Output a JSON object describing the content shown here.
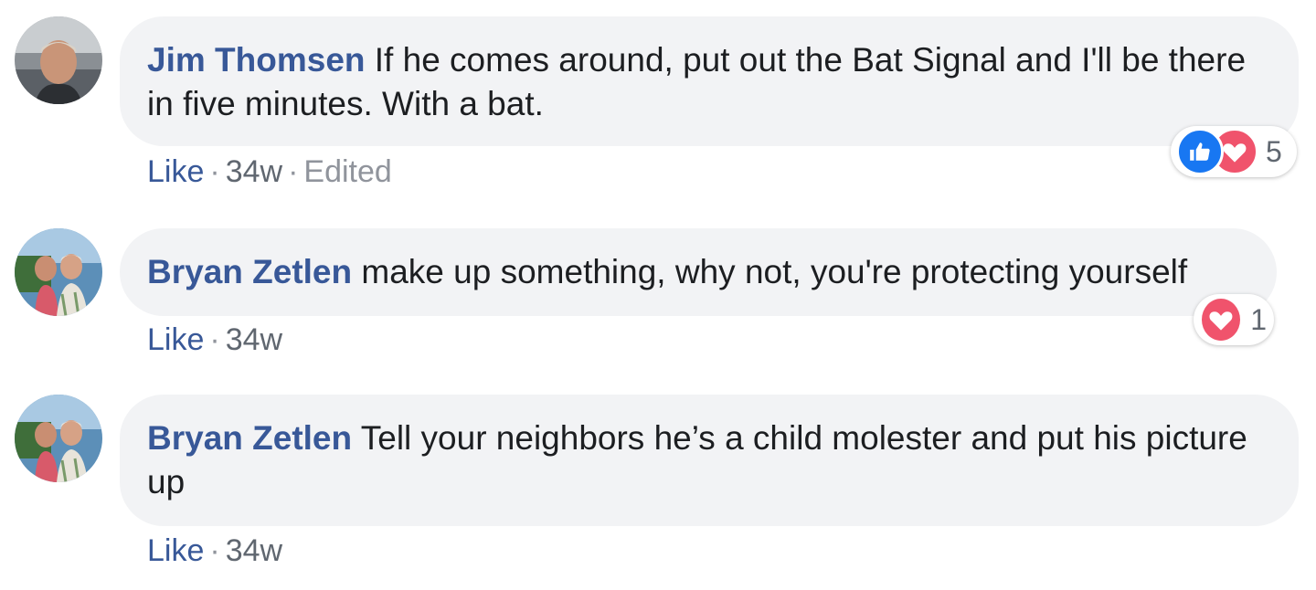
{
  "comments": [
    {
      "author": "Jim Thomsen",
      "text": "If he comes around, put out the Bat Signal and I'll be there in five minutes. With a bat.",
      "like_label": "Like",
      "time": "34w",
      "edited": "Edited",
      "reactions": [
        "like-icon",
        "love-icon"
      ],
      "reaction_count": "5"
    },
    {
      "author": "Bryan Zetlen",
      "text": "make up something, why not, you're protecting yourself",
      "like_label": "Like",
      "time": "34w",
      "reactions": [
        "love-icon"
      ],
      "reaction_count": "1"
    },
    {
      "author": "Bryan Zetlen",
      "text": "Tell your neighbors he’s a child molester and put his picture up",
      "like_label": "Like",
      "time": "34w"
    }
  ],
  "colors": {
    "author": "#385898",
    "bubble": "#f2f3f5",
    "like_reaction": "#1877f2",
    "love_reaction": "#f0536c"
  }
}
